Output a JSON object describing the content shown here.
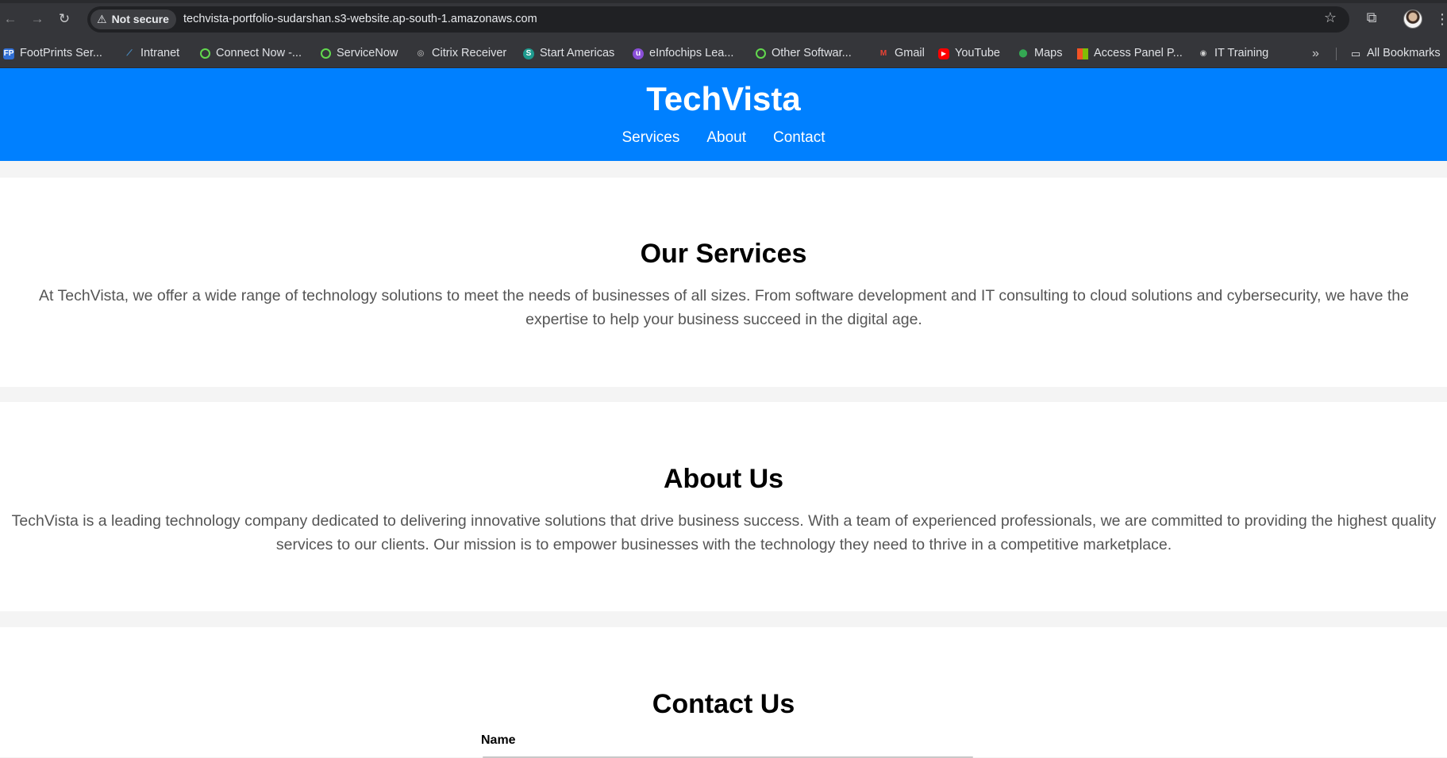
{
  "browser": {
    "security_label": "Not secure",
    "url": "techvista-portfolio-sudarshan.s3-website.ap-south-1.amazonaws.com",
    "bookmarks": [
      {
        "label": "FootPrints Ser...",
        "icon": "footprints-icon",
        "color": "#2f6fd6"
      },
      {
        "label": "Intranet",
        "icon": "feather-icon",
        "color": "#4a90c8"
      },
      {
        "label": "Connect Now -...",
        "icon": "servicenow-icon",
        "color": "#62d84e"
      },
      {
        "label": "ServiceNow",
        "icon": "servicenow-icon",
        "color": "#62d84e"
      },
      {
        "label": "Citrix Receiver",
        "icon": "citrix-icon",
        "color": "#cfcfcf"
      },
      {
        "label": "Start Americas",
        "icon": "sharepoint-icon",
        "color": "#1e9a8e"
      },
      {
        "label": "eInfochips Lea...",
        "icon": "einfochips-icon",
        "color": "#8a4fd8"
      },
      {
        "label": "Other Softwar...",
        "icon": "servicenow-icon",
        "color": "#62d84e"
      },
      {
        "label": "Gmail",
        "icon": "gmail-icon",
        "color": "#ea4335"
      },
      {
        "label": "YouTube",
        "icon": "youtube-icon",
        "color": "#ff0000"
      },
      {
        "label": "Maps",
        "icon": "maps-icon",
        "color": "#34a853"
      },
      {
        "label": "Access Panel P...",
        "icon": "microsoft-icon",
        "color": "#f35325"
      },
      {
        "label": "IT Training",
        "icon": "globe-icon",
        "color": "#cfcfcf"
      }
    ],
    "all_bookmarks_label": "All Bookmarks"
  },
  "site": {
    "title": "TechVista",
    "nav": [
      "Services",
      "About",
      "Contact"
    ],
    "brand_color": "#0080ff"
  },
  "services": {
    "heading": "Our Services",
    "body": "At TechVista, we offer a wide range of technology solutions to meet the needs of businesses of all sizes. From software development and IT consulting to cloud solutions and cybersecurity, we have the expertise to help your business succeed in the digital age."
  },
  "about": {
    "heading": "About Us",
    "body": "TechVista is a leading technology company dedicated to delivering innovative solutions that drive business success. With a team of experienced professionals, we are committed to providing the highest quality services to our clients. Our mission is to empower businesses with the technology they need to thrive in a competitive marketplace."
  },
  "contact": {
    "heading": "Contact Us",
    "name_label": "Name"
  }
}
